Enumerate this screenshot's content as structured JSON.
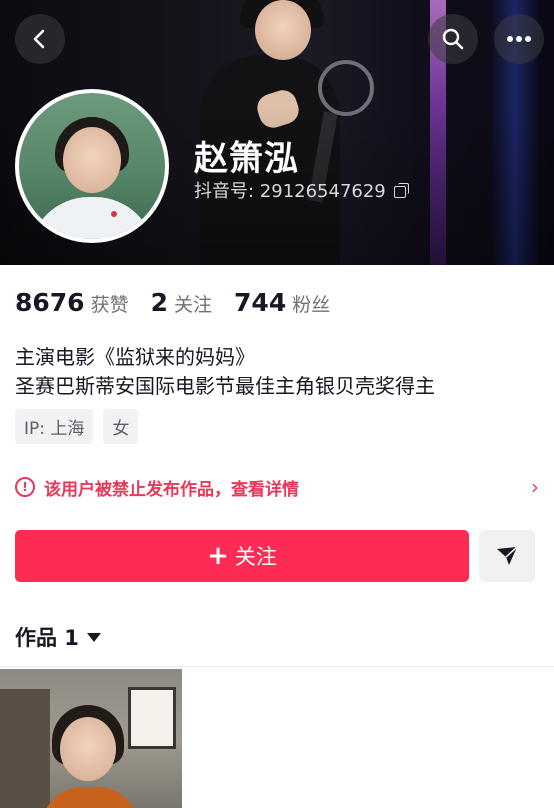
{
  "header": {
    "back_icon": "chevron-left-icon",
    "search_icon": "search-icon",
    "more_icon": "more-dots-icon"
  },
  "profile": {
    "name": "赵箫泓",
    "uid_label": "抖音号: 29126547629",
    "copy_icon": "copy-icon"
  },
  "stats": [
    {
      "value": "8676",
      "label": "获赞"
    },
    {
      "value": "2",
      "label": "关注"
    },
    {
      "value": "744",
      "label": "粉丝"
    }
  ],
  "bio": {
    "line1": "主演电影《监狱来的妈妈》",
    "line2": "圣赛巴斯蒂安国际电影节最佳主角银贝壳奖得主"
  },
  "tags": [
    "IP: 上海",
    "女"
  ],
  "ban_notice": {
    "text": "该用户被禁止发布作品，查看详情",
    "chevron": "›",
    "color": "#e8385a"
  },
  "actions": {
    "follow_plus": "+",
    "follow_label": "关注",
    "follow_color": "#fe2c55",
    "share_icon": "send-icon"
  },
  "works": {
    "tab_label": "作品 1"
  }
}
